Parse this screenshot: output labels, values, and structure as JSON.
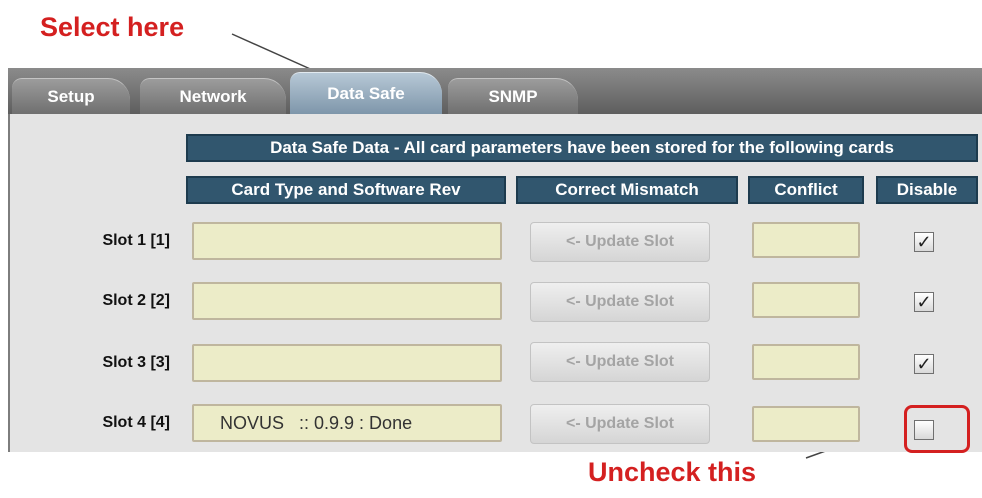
{
  "annotations": {
    "top": "Select here",
    "bottom": "Uncheck this"
  },
  "tabs": [
    {
      "label": "Setup",
      "active": false
    },
    {
      "label": "Network",
      "active": false
    },
    {
      "label": "Data Safe",
      "active": true
    },
    {
      "label": "SNMP",
      "active": false
    }
  ],
  "banner": "Data Safe Data - All card parameters have been stored for the following cards",
  "columns": {
    "card_type": "Card Type and Software Rev",
    "correct_mismatch": "Correct Mismatch",
    "conflict": "Conflict",
    "disable": "Disable"
  },
  "slots": [
    {
      "label": "Slot 1 [1]",
      "card_value": "",
      "button": "<- Update Slot",
      "conflict": "",
      "disabled": true
    },
    {
      "label": "Slot 2 [2]",
      "card_value": "",
      "button": "<- Update Slot",
      "conflict": "",
      "disabled": true
    },
    {
      "label": "Slot 3 [3]",
      "card_value": "",
      "button": "<- Update Slot",
      "conflict": "",
      "disabled": true
    },
    {
      "label": "Slot 4 [4]",
      "card_value": "NOVUS   :: 0.9.9 : Done",
      "button": "<- Update Slot",
      "conflict": "",
      "disabled": false
    }
  ],
  "colors": {
    "annotation": "#d42020",
    "header_bg": "#31566e",
    "field_bg": "#ececc8"
  }
}
